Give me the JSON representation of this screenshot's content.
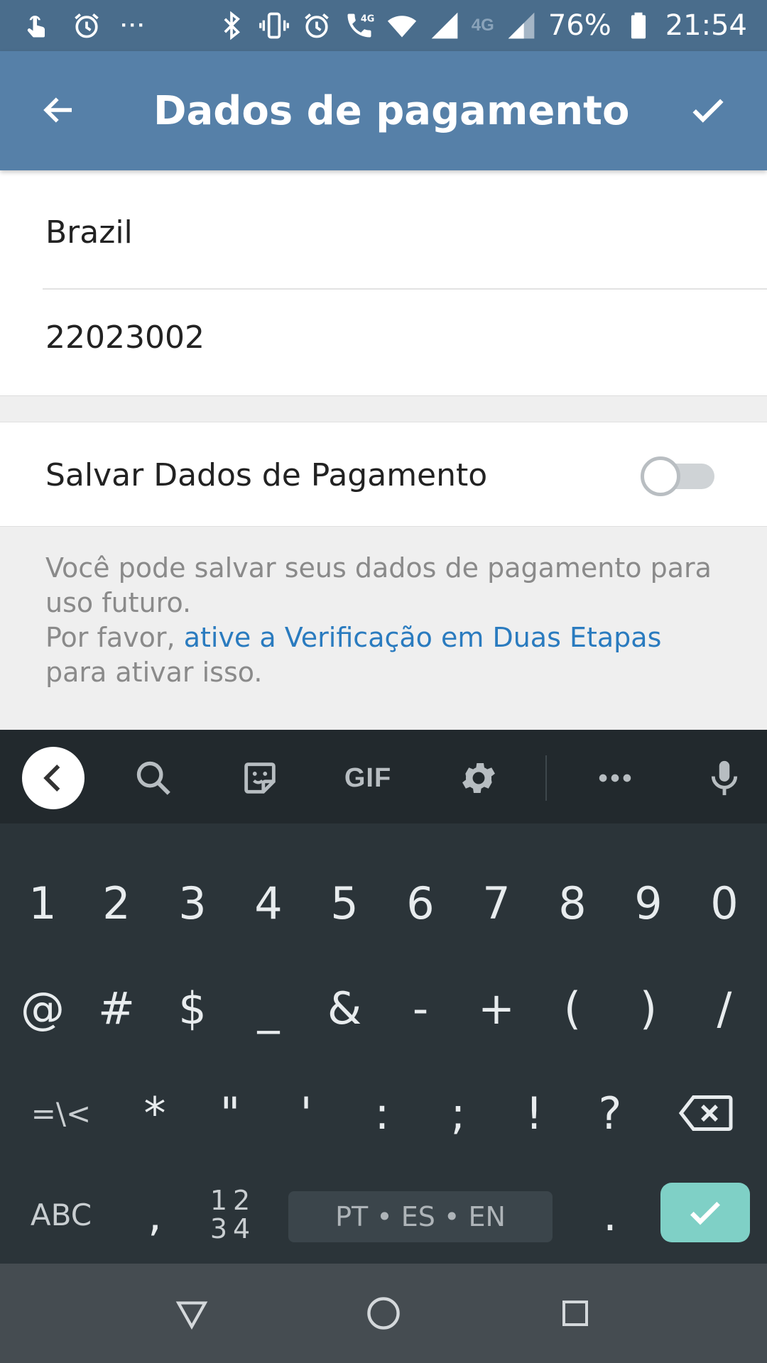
{
  "status_bar": {
    "notification_dots": "···",
    "network_type": "4G",
    "battery": "76%",
    "time": "21:54"
  },
  "app_bar": {
    "title": "Dados de pagamento"
  },
  "form": {
    "country": "Brazil",
    "postal_code": "22023002"
  },
  "save_toggle": {
    "label": "Salvar Dados de Pagamento",
    "enabled": false
  },
  "info": {
    "line1": "Você pode salvar seus dados de pagamento para uso futuro.",
    "line2_prefix": "Por favor, ",
    "link": "ative a Verificação em Duas Etapas",
    "line2_suffix": " para ativar isso."
  },
  "keyboard": {
    "toolbar": {
      "gif_label": "GIF"
    },
    "row_numbers": [
      "1",
      "2",
      "3",
      "4",
      "5",
      "6",
      "7",
      "8",
      "9",
      "0"
    ],
    "row_symbols1": [
      "@",
      "#",
      "$",
      "_",
      "&",
      "-",
      "+",
      "(",
      ")",
      "/"
    ],
    "row_symbols2": [
      "=\\<",
      "*",
      "\"",
      "'",
      ":",
      ";",
      "!",
      "?"
    ],
    "row_bottom": {
      "abc": "ABC",
      "comma": ",",
      "num_top": "12",
      "num_bottom": "34",
      "space": "PT • ES • EN",
      "period": "."
    },
    "enter_color": "#7fd0c6"
  }
}
